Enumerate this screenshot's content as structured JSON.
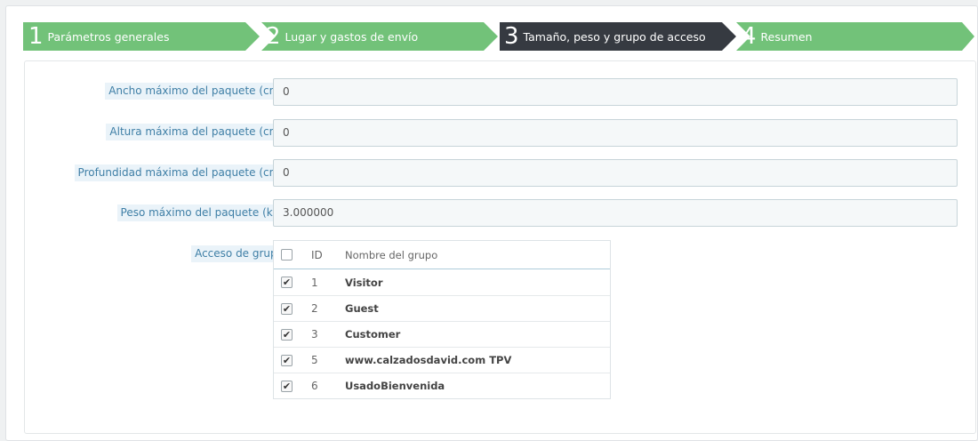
{
  "wizard": {
    "steps": [
      {
        "number": "1",
        "label": "Parámetros generales",
        "state": "done",
        "color": "#72c279"
      },
      {
        "number": "2",
        "label": "Lugar y gastos de envío",
        "state": "done",
        "color": "#72c279"
      },
      {
        "number": "3",
        "label": "Tamaño, peso y grupo de acceso",
        "state": "current",
        "color": "#363a41"
      },
      {
        "number": "4",
        "label": "Resumen",
        "state": "todo",
        "color": "#72c279"
      }
    ]
  },
  "form": {
    "max_width": {
      "label": "Ancho máximo del paquete (cm)",
      "value": "0"
    },
    "max_height": {
      "label": "Altura máxima del paquete (cm)",
      "value": "0"
    },
    "max_depth": {
      "label": "Profundidad máxima del paquete (cm)",
      "value": "0"
    },
    "max_weight": {
      "label": "Peso máximo del paquete (kg)",
      "value": "3.000000"
    },
    "group_access": {
      "label": "Acceso de grupo",
      "columns": {
        "id": "ID",
        "name": "Nombre del grupo"
      },
      "rows": [
        {
          "id": "1",
          "name": "Visitor",
          "checked": true
        },
        {
          "id": "2",
          "name": "Guest",
          "checked": true
        },
        {
          "id": "3",
          "name": "Customer",
          "checked": true
        },
        {
          "id": "5",
          "name": "www.calzadosdavid.com TPV",
          "checked": true
        },
        {
          "id": "6",
          "name": "UsadoBienvenida",
          "checked": true
        }
      ]
    }
  },
  "icons": {
    "check": "✔"
  }
}
